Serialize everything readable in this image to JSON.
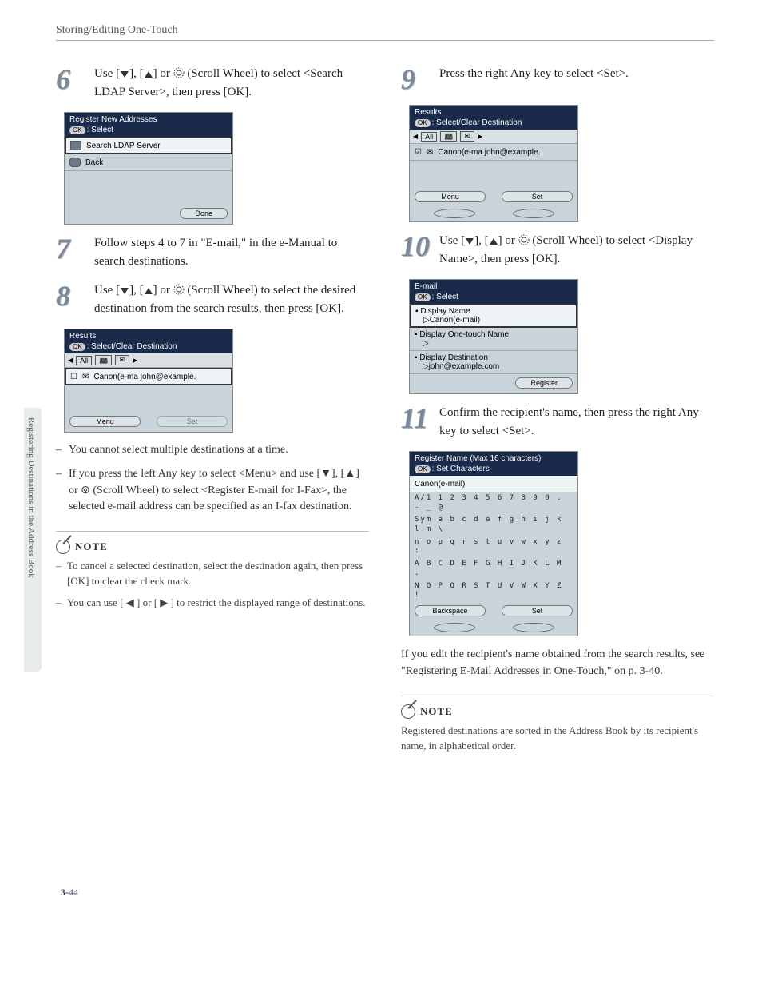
{
  "header": "Storing/Editing One-Touch",
  "sidetab": "Registering Destinations in the Address Book",
  "page_num_prefix": "3-",
  "page_num": "44",
  "steps": {
    "s6": {
      "num": "6",
      "text_a": "Use [",
      "text_b": "], [",
      "text_c": "] or ",
      "text_d": " (Scroll Wheel) to select <Search LDAP Server>, then press [OK]."
    },
    "s7": {
      "num": "7",
      "text": "Follow steps 4 to 7 in \"E-mail,\" in the e-Manual to search destinations."
    },
    "s8": {
      "num": "8",
      "text_a": "Use [",
      "text_b": "], [",
      "text_c": "] or ",
      "text_d": " (Scroll Wheel) to select the desired destination from the search results, then press [OK]."
    },
    "s8_bullets": [
      "You cannot select multiple destinations at a time.",
      "If you press the left Any key to select <Menu> and use [▼], [▲] or ⊚ (Scroll Wheel) to select <Register E-mail for I-Fax>, the selected e-mail address can be specified as an I-fax destination."
    ],
    "s8_note": [
      "To cancel a selected destination, select the destination again, then press [OK] to clear the check mark.",
      "You can use [ ◀ ] or [ ▶ ] to restrict the displayed range of destinations."
    ],
    "s9": {
      "num": "9",
      "text": "Press the right Any key to select <Set>."
    },
    "s10": {
      "num": "10",
      "text_a": "Use [",
      "text_b": "], [",
      "text_c": "] or ",
      "text_d": " (Scroll Wheel) to select <Display Name>, then press [OK]."
    },
    "s11": {
      "num": "11",
      "text": "Confirm the recipient's name, then press the right Any key to select <Set>."
    },
    "s11_after": "If you edit the recipient's name obtained from the search results, see \"Registering E-Mail Addresses in One-Touch,\" on p. 3-40.",
    "s11_note": "Registered destinations are sorted in the Address Book by its recipient's name, in alphabetical order."
  },
  "lcd6": {
    "title1": "Register New Addresses",
    "title2": ": Select",
    "row1": "Search LDAP Server",
    "row2": "Back",
    "done": "Done"
  },
  "lcd8": {
    "title1": "Results",
    "title2": ": Select/Clear Destination",
    "all": "All",
    "row": "Canon(e-ma john@example.",
    "menu": "Menu",
    "set": "Set"
  },
  "lcd9": {
    "title1": "Results",
    "title2": ": Select/Clear Destination",
    "all": "All",
    "row": "Canon(e-ma john@example.",
    "menu": "Menu",
    "set": "Set"
  },
  "lcd10": {
    "title1": "E-mail",
    "title2": ": Select",
    "r1": "Display Name",
    "r1b": "▷Canon(e-mail)",
    "r2": "Display One-touch Name",
    "r2b": "▷",
    "r3": "Display Destination",
    "r3b": "▷john@example.com",
    "reg": "Register"
  },
  "lcd11": {
    "title1": "Register Name (Max 16 characters)",
    "title2": ": Set Characters",
    "entry": "Canon(e-mail)",
    "line1": "A/1  1 2 3 4 5 6 7 8 9 0 . - _ @",
    "line2": "Sym  a b c d e f g h i j k l m \\",
    "line3": "     n o p q r s t u v w x y z :",
    "line4": "     A B C D E F G H I J K L M .",
    "line5": "     N O P Q R S T U V W X Y Z !",
    "back": "Backspace",
    "set": "Set"
  },
  "note_label": "NOTE"
}
